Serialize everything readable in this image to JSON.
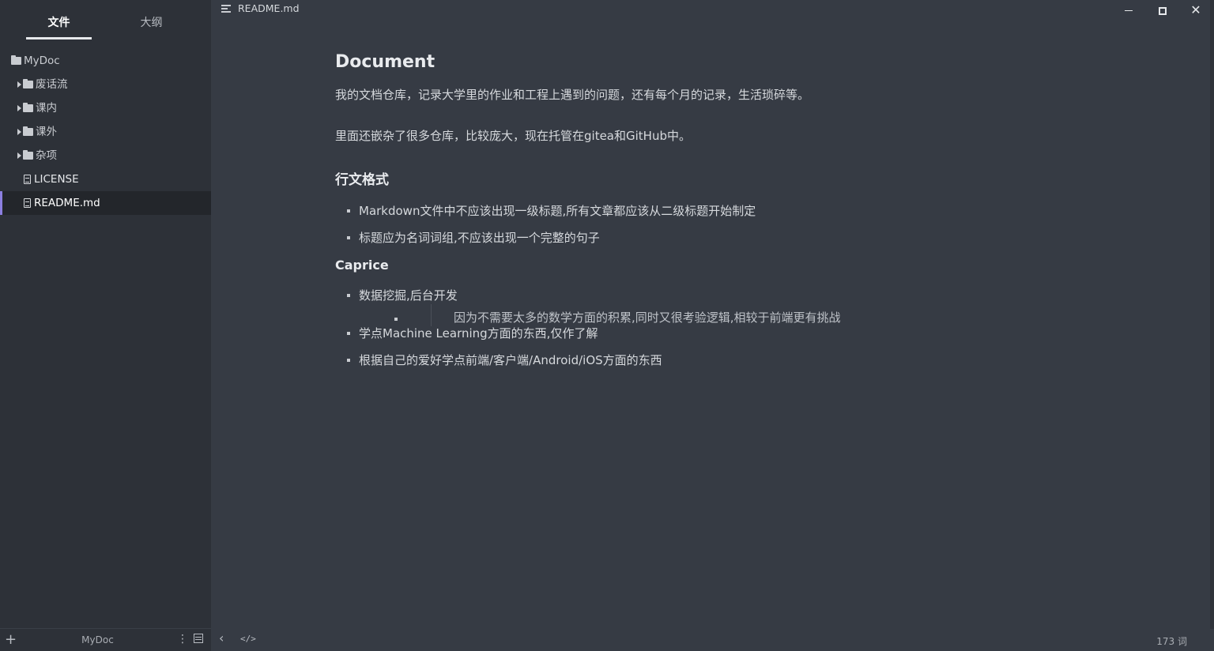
{
  "sidebar": {
    "tabs": {
      "files": "文件",
      "outline": "大纲"
    },
    "root": "MyDoc",
    "folders": [
      "废话流",
      "课内",
      "课外",
      "杂项"
    ],
    "files": [
      "LICENSE",
      "README.md"
    ],
    "active_file": "README.md",
    "footer": {
      "add": "+",
      "folder_name": "MyDoc",
      "more": "⋮"
    }
  },
  "titlebar": {
    "title": "README.md",
    "close": "✕"
  },
  "doc": {
    "h1": "Document",
    "p1": "我的文档仓库，记录大学里的作业和工程上遇到的问题，还有每个月的记录，生活琐碎等。",
    "p2": "里面还嵌杂了很多仓库，比较庞大，现在托管在gitea和GitHub中。",
    "h2": "行文格式",
    "format_items": [
      "Markdown文件中不应该出现一级标题,所有文章都应该从二级标题开始制定",
      "标题应为名词词组,不应该出现一个完整的句子"
    ],
    "h3": "Caprice",
    "caprice_items": [
      "数据挖掘,后台开发",
      "学点Machine Learning方面的东西,仅作了解",
      "根据自己的爱好学点前端/客户端/Android/iOS方面的东西"
    ],
    "caprice_sub": "因为不需要太多的数学方面的积累,同时又很考验逻辑,相较于前端更有挑战"
  },
  "status": {
    "back": "‹",
    "source": "</>",
    "wordcount": "173 词"
  },
  "colors": {
    "background": "#363b44",
    "sidebar": "#2d3138",
    "accent": "#8c7fe0"
  }
}
